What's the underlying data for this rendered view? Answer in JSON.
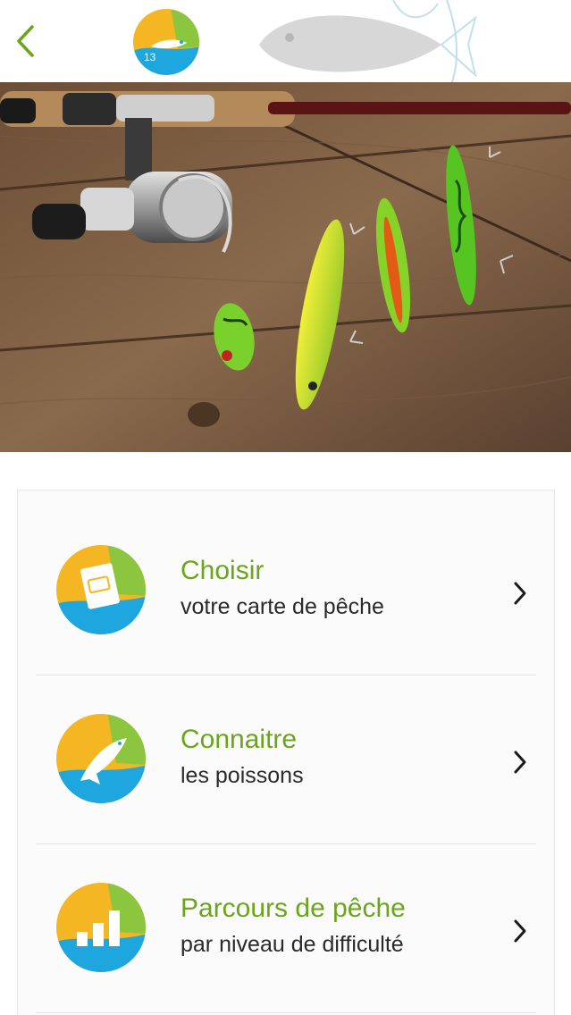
{
  "header": {
    "back_icon": "chevron-left-icon",
    "logo_text": "13",
    "accent_green": "#6aa51b",
    "accent_yellow": "#f4b623",
    "accent_blue": "#1ea6df"
  },
  "hero": {
    "image": "fishing-rod-and-lures-photo"
  },
  "menu": {
    "items": [
      {
        "title": "Choisir",
        "subtitle": "votre carte de pêche",
        "icon": "fishing-card-icon"
      },
      {
        "title": "Connaitre",
        "subtitle": "les poissons",
        "icon": "jumping-fish-icon"
      },
      {
        "title": "Parcours de pêche",
        "subtitle": "par niveau de difficulté",
        "icon": "difficulty-bars-icon"
      }
    ]
  }
}
